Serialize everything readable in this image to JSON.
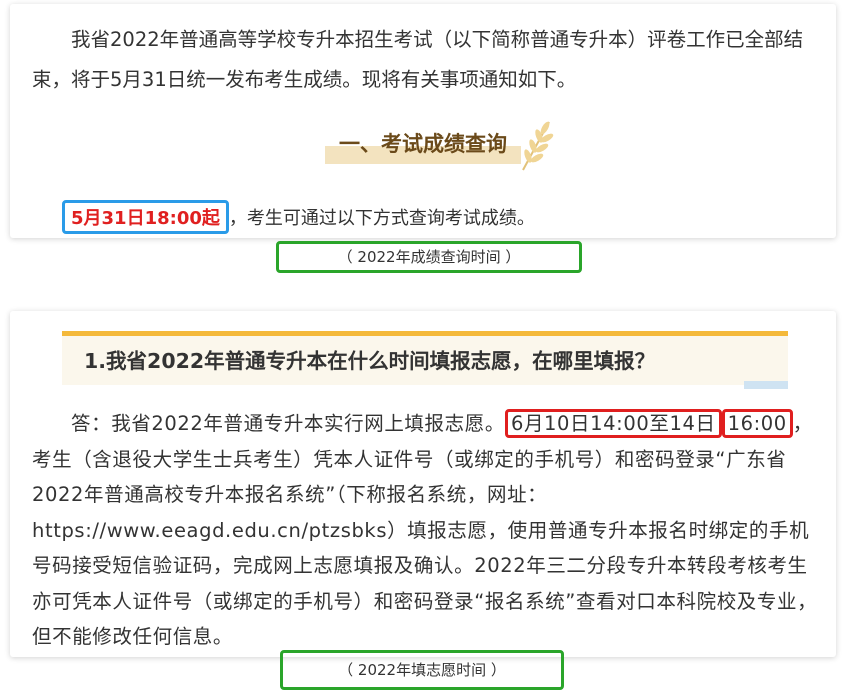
{
  "section1": {
    "intro": "我省2022年普通高等学校专升本招生考试（以下简称普通专升本）评卷工作已全部结束，将于5月31日统一发布考生成绩。现将有关事项通知如下。",
    "heading": "一、考试成绩查询",
    "time_highlight": "5月31日18:00起",
    "time_rest": "，考生可通过以下方式查询考试成绩。",
    "caption": "（ 2022年成绩查询时间 ）"
  },
  "section2": {
    "question": "1.我省2022年普通专升本在什么时间填报志愿，在哪里填报？",
    "answer_before": "答：我省2022年普通专升本实行网上填报志愿。",
    "answer_time_a": "6月10日14:00至14日",
    "answer_time_b": "16:00",
    "answer_after": "，考生（含退役大学生士兵考生）凭本人证件号（或绑定的手机号）和密码登录“广东省2022年普通高校专升本报名系统”（下称报名系统，网址：https://www.eeagd.edu.cn/ptzsbks）填报志愿，使用普通专升本报名时绑定的手机号码接受短信验证码，完成网上志愿填报及确认。2022年三二分段专升本转段考核考生亦可凭本人证件号（或绑定的手机号）和密码登录“报名系统”查看对口本科院校及专业，但不能修改任何信息。",
    "caption": "（ 2022年填志愿时间 ）"
  },
  "colors": {
    "heading_brown": "#6b4a1a",
    "accent_gold": "#f4b93a",
    "highlight_red": "#e01f1f",
    "box_blue": "#2a9be8",
    "box_green": "#2aa52a"
  },
  "icons": {
    "heading_decoration": "wheat-icon"
  }
}
